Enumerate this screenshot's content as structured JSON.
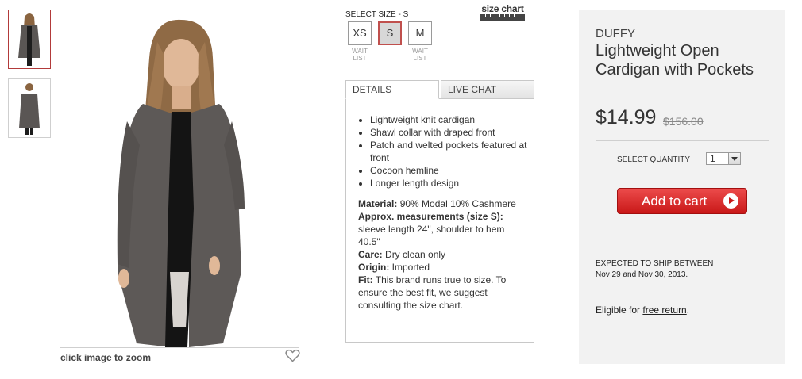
{
  "gallery": {
    "thumbnails": [
      {
        "alt": "front view",
        "selected": true
      },
      {
        "alt": "back view",
        "selected": false
      }
    ],
    "zoom_hint": "click image to zoom",
    "favorite_icon": "heart-icon"
  },
  "size": {
    "label": "SELECT SIZE - ",
    "selected": "S",
    "chart_label": "size chart",
    "options": [
      {
        "label": "XS",
        "note": "WAIT LIST"
      },
      {
        "label": "S",
        "note": ""
      },
      {
        "label": "M",
        "note": "WAIT LIST"
      }
    ]
  },
  "tabs": [
    {
      "label": "DETAILS",
      "active": true
    },
    {
      "label": "LIVE CHAT",
      "active": false
    }
  ],
  "details": {
    "bullets": [
      "Lightweight knit cardigan",
      "Shawl collar with draped front",
      "Patch and welted pockets featured at front",
      "Cocoon hemline",
      "Longer length design"
    ],
    "material_label": "Material:",
    "material": " 90% Modal 10% Cashmere",
    "measure_label": "Approx. measurements (size S):",
    "measure": " sleeve length 24\", shoulder to hem 40.5\"",
    "care_label": "Care:",
    "care": " Dry clean only",
    "origin_label": "Origin:",
    "origin": " Imported",
    "fit_label": "Fit:",
    "fit": " This brand runs true to size. To ensure the best fit, we suggest consulting the size chart."
  },
  "product": {
    "brand": "DUFFY",
    "title": "Lightweight Open Cardigan with Pockets",
    "price": "$14.99",
    "old_price": "$156.00",
    "qty_label": "SELECT QUANTITY",
    "qty_value": "1",
    "add_to_cart": "Add to cart",
    "ship_line1": "EXPECTED TO SHIP BETWEEN",
    "ship_line2": "Nov 29 and Nov 30, 2013.",
    "eligible_prefix": "Eligible for ",
    "eligible_link": "free return",
    "eligible_suffix": "."
  },
  "colors": {
    "accent_red": "#c91818",
    "selected_border": "#c0504d",
    "buybox_bg": "#f2f2f2"
  }
}
